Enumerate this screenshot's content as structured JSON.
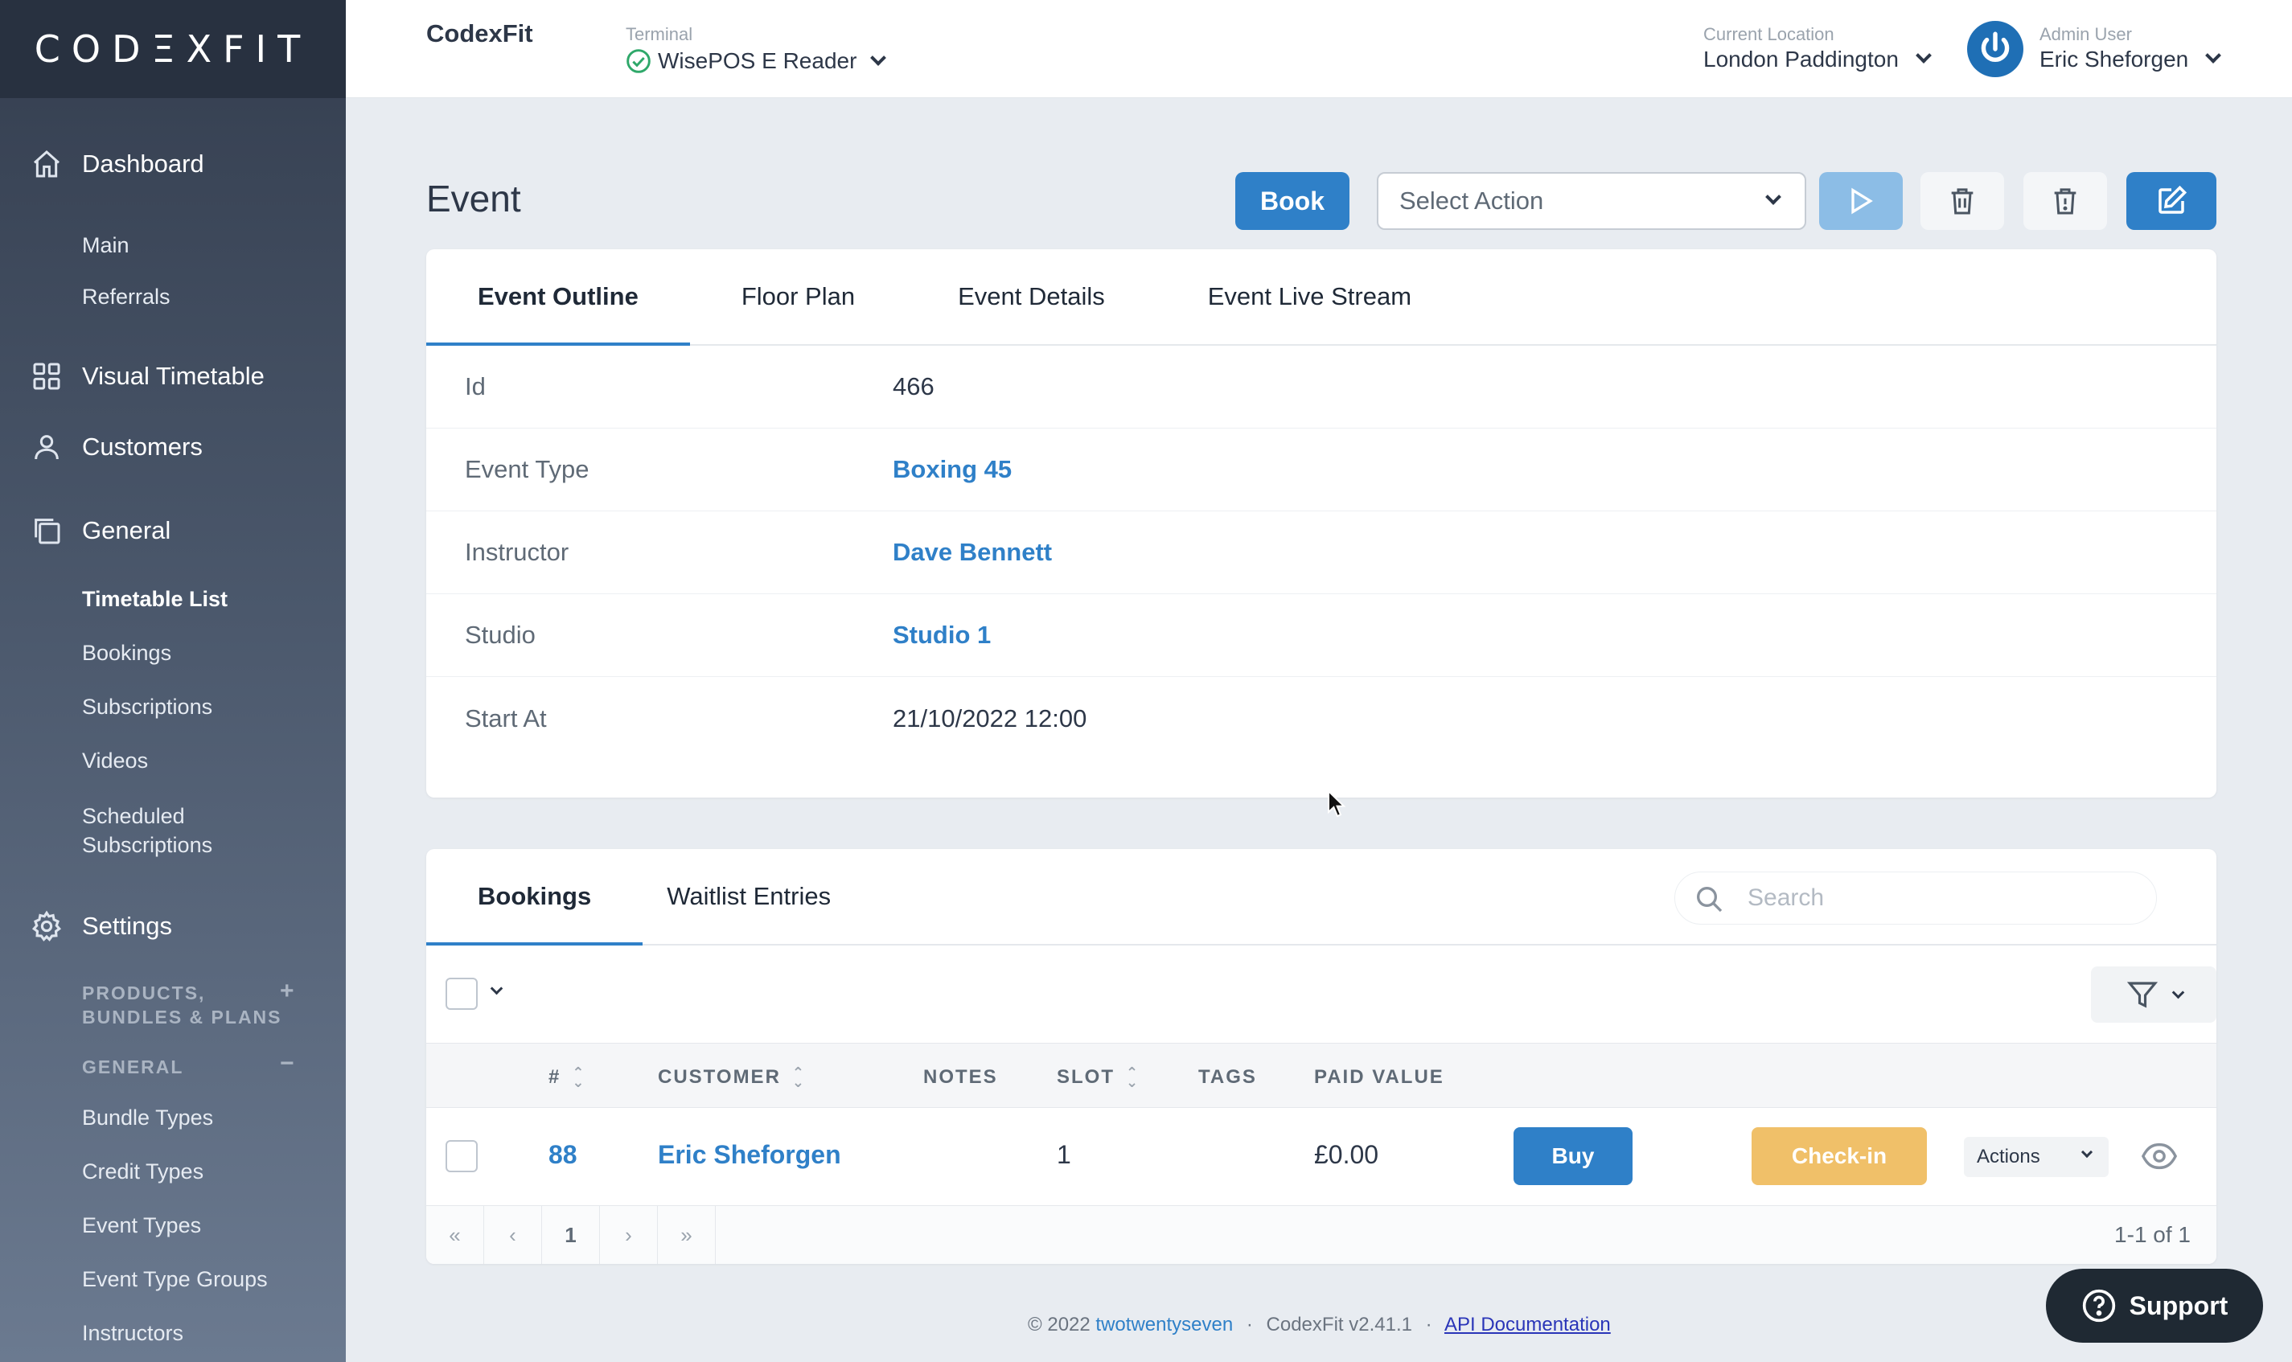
{
  "sidebar": {
    "logo": "CODΞXFIT",
    "dashboard": "Dashboard",
    "main": "Main",
    "referrals": "Referrals",
    "visual_timetable": "Visual Timetable",
    "customers": "Customers",
    "general": "General",
    "timetable_list": "Timetable List",
    "bookings": "Bookings",
    "subscriptions": "Subscriptions",
    "videos": "Videos",
    "scheduled_line1": "Scheduled",
    "scheduled_line2": "Subscriptions",
    "settings": "Settings",
    "group_products_line1": "PRODUCTS,",
    "group_products_line2": "BUNDLES & PLANS",
    "group_products_toggle": "+",
    "group_general": "GENERAL",
    "group_general_toggle": "−",
    "bundle_types": "Bundle Types",
    "credit_types": "Credit Types",
    "event_types": "Event Types",
    "event_type_groups": "Event Type Groups",
    "instructors": "Instructors"
  },
  "topbar": {
    "brand": "CodexFit",
    "terminal_label": "Terminal",
    "terminal_value": "WisePOS E Reader",
    "location_label": "Current Location",
    "location_value": "London Paddington",
    "user_label": "Admin User",
    "user_value": "Eric Sheforgen"
  },
  "header": {
    "title": "Event",
    "book": "Book",
    "select_action": "Select Action"
  },
  "event_tabs": [
    "Event Outline",
    "Floor Plan",
    "Event Details",
    "Event Live Stream"
  ],
  "details": {
    "id_label": "Id",
    "id_value": "466",
    "type_label": "Event Type",
    "type_value": "Boxing 45",
    "instructor_label": "Instructor",
    "instructor_value": "Dave Bennett",
    "studio_label": "Studio",
    "studio_value": "Studio 1",
    "start_label": "Start At",
    "start_value": "21/10/2022 12:00"
  },
  "booking_tabs": [
    "Bookings",
    "Waitlist Entries"
  ],
  "search": {
    "placeholder": "Search"
  },
  "table": {
    "headers": [
      "#",
      "CUSTOMER",
      "NOTES",
      "SLOT",
      "TAGS",
      "PAID VALUE"
    ],
    "row": {
      "number": "88",
      "customer": "Eric Sheforgen",
      "slot": "1",
      "paid": "£0.00",
      "buy": "Buy",
      "checkin": "Check-in",
      "actions": "Actions"
    }
  },
  "pager": {
    "first": "«",
    "prev": "‹",
    "page": "1",
    "next": "›",
    "last": "»",
    "info": "1-1 of 1"
  },
  "footer": {
    "copyright": "© 2022",
    "company": "twotwentyseven",
    "sep1": "·",
    "version": "CodexFit v2.41.1",
    "sep2": "·",
    "api": "API Documentation"
  },
  "support": "Support",
  "colors": {
    "accent": "#2f80c8",
    "checkin": "#f0c069",
    "sidebar": "#343e4f",
    "success": "#2fa86a"
  }
}
